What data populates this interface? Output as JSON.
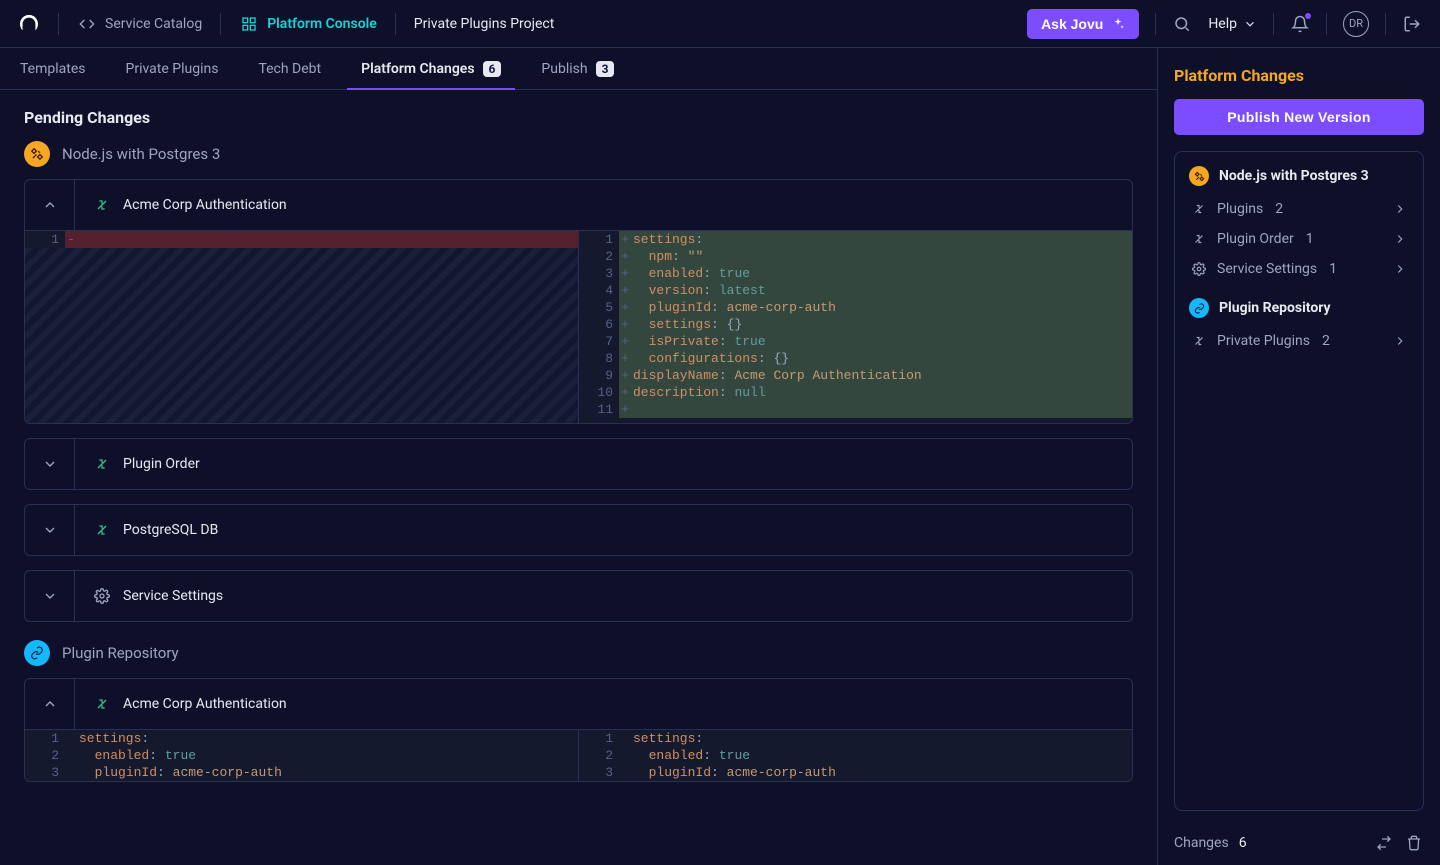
{
  "topnav": {
    "service_catalog": "Service Catalog",
    "platform_console": "Platform Console",
    "project": "Private Plugins Project",
    "ask_jovu": "Ask Jovu",
    "help": "Help",
    "avatar": "DR"
  },
  "subtabs": {
    "templates": "Templates",
    "private_plugins": "Private Plugins",
    "tech_debt": "Tech Debt",
    "platform_changes": "Platform Changes",
    "platform_changes_count": "6",
    "publish": "Publish",
    "publish_count": "3"
  },
  "page_title": "Pending Changes",
  "group1": {
    "title": "Node.js with Postgres 3"
  },
  "panels": {
    "auth": {
      "title": "Acme Corp Authentication",
      "left_lines": [
        {
          "n": "1",
          "mark": "-",
          "type": "rem",
          "html": ""
        }
      ],
      "right_lines": [
        {
          "n": "1",
          "mark": "+",
          "type": "add",
          "html": "<span class=\"tk-k\">settings</span><span class=\"tk-p\">:</span>"
        },
        {
          "n": "2",
          "mark": "+",
          "type": "add",
          "html": "  <span class=\"tk-k\">npm</span><span class=\"tk-p\">:</span> <span class=\"tk-s\">\"\"</span>"
        },
        {
          "n": "3",
          "mark": "+",
          "type": "add",
          "html": "  <span class=\"tk-k\">enabled</span><span class=\"tk-p\">:</span> <span class=\"tk-b\">true</span>"
        },
        {
          "n": "4",
          "mark": "+",
          "type": "add",
          "html": "  <span class=\"tk-k\">version</span><span class=\"tk-p\">:</span> <span class=\"tk-b\">latest</span>"
        },
        {
          "n": "5",
          "mark": "+",
          "type": "add",
          "html": "  <span class=\"tk-k\">pluginId</span><span class=\"tk-p\">:</span> <span class=\"tk-s\">acme-corp-auth</span>"
        },
        {
          "n": "6",
          "mark": "+",
          "type": "add",
          "html": "  <span class=\"tk-k\">settings</span><span class=\"tk-p\">:</span> <span class=\"tk-p\">{}</span>"
        },
        {
          "n": "7",
          "mark": "+",
          "type": "add",
          "html": "  <span class=\"tk-k\">isPrivate</span><span class=\"tk-p\">:</span> <span class=\"tk-b\">true</span>"
        },
        {
          "n": "8",
          "mark": "+",
          "type": "add",
          "html": "  <span class=\"tk-k\">configurations</span><span class=\"tk-p\">:</span> <span class=\"tk-p\">{}</span>"
        },
        {
          "n": "9",
          "mark": "+",
          "type": "add",
          "html": "<span class=\"tk-k\">displayName</span><span class=\"tk-p\">:</span> <span class=\"tk-s\">Acme Corp Authentication</span>"
        },
        {
          "n": "10",
          "mark": "+",
          "type": "add",
          "html": "<span class=\"tk-k\">description</span><span class=\"tk-p\">:</span> <span class=\"tk-b\">null</span>"
        },
        {
          "n": "11",
          "mark": "+",
          "type": "add",
          "html": ""
        }
      ]
    },
    "plugin_order": {
      "title": "Plugin Order"
    },
    "postgres": {
      "title": "PostgreSQL DB"
    },
    "service_settings": {
      "title": "Service Settings"
    },
    "auth2": {
      "title": "Acme Corp Authentication",
      "left_lines": [
        {
          "n": "1",
          "mark": "",
          "type": "",
          "html": "<span class=\"tk-k\">settings</span><span class=\"tk-p\">:</span>"
        },
        {
          "n": "2",
          "mark": "",
          "type": "",
          "html": "  <span class=\"tk-k\">enabled</span><span class=\"tk-p\">:</span> <span class=\"tk-b\">true</span>"
        },
        {
          "n": "3",
          "mark": "",
          "type": "",
          "html": "  <span class=\"tk-k\">pluginId</span><span class=\"tk-p\">:</span> <span class=\"tk-s\">acme-corp-auth</span>"
        }
      ],
      "right_lines": [
        {
          "n": "1",
          "mark": "",
          "type": "",
          "html": "<span class=\"tk-k\">settings</span><span class=\"tk-p\">:</span>"
        },
        {
          "n": "2",
          "mark": "",
          "type": "",
          "html": "  <span class=\"tk-k\">enabled</span><span class=\"tk-p\">:</span> <span class=\"tk-b\">true</span>"
        },
        {
          "n": "3",
          "mark": "",
          "type": "",
          "html": "  <span class=\"tk-k\">pluginId</span><span class=\"tk-p\">:</span> <span class=\"tk-s\">acme-corp-auth</span>"
        }
      ]
    }
  },
  "group2": {
    "title": "Plugin Repository"
  },
  "sidebar": {
    "heading": "Platform Changes",
    "publish": "Publish New Version",
    "group1": "Node.js with Postgres 3",
    "items1": [
      {
        "label": "Plugins",
        "count": "2"
      },
      {
        "label": "Plugin Order",
        "count": "1"
      },
      {
        "label": "Service Settings",
        "count": "1"
      }
    ],
    "group2": "Plugin Repository",
    "items2": [
      {
        "label": "Private Plugins",
        "count": "2"
      }
    ],
    "footer_label": "Changes",
    "footer_count": "6"
  }
}
